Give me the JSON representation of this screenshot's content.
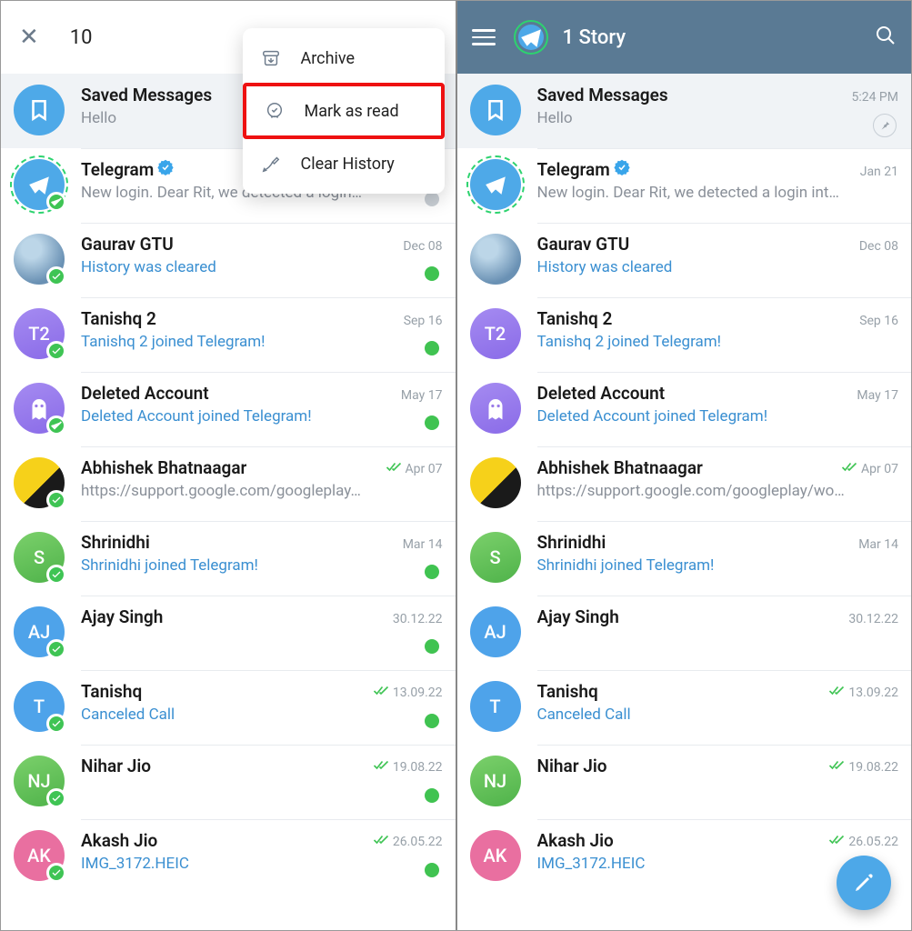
{
  "left": {
    "selected_count": "10",
    "menu": {
      "archive": "Archive",
      "mark_read": "Mark as read",
      "clear_history": "Clear History"
    }
  },
  "right": {
    "title": "1 Story"
  },
  "chats": [
    {
      "name": "Saved Messages",
      "msg": "Hello",
      "date_left": "",
      "date_right": "5:24 PM",
      "link": false,
      "verified": false,
      "read": false
    },
    {
      "name": "Telegram",
      "msg_left": "New login. Dear Rit, we detected a login…",
      "msg_right": "New login. Dear Rit, we detected a login int…",
      "date_left": "",
      "date_right": "Jan 21",
      "link": false,
      "verified": true,
      "read": false
    },
    {
      "name": "Gaurav GTU",
      "msg": "History was cleared",
      "date": "Dec 08",
      "link": true,
      "read": false
    },
    {
      "name": "Tanishq 2",
      "msg": "Tanishq 2 joined Telegram!",
      "date": "Sep 16",
      "link": true,
      "initials": "T2"
    },
    {
      "name": "Deleted Account",
      "msg": "Deleted Account joined Telegram!",
      "date": "May 17",
      "link": true
    },
    {
      "name": "Abhishek Bhatnaagar",
      "msg_left": "https://support.google.com/googleplay…",
      "msg_right": "https://support.google.com/googleplay/wo…",
      "date": "Apr 07",
      "link": false,
      "read": true
    },
    {
      "name": "Shrinidhi",
      "msg": "Shrinidhi joined Telegram!",
      "date": "Mar 14",
      "link": true,
      "initials": "S"
    },
    {
      "name": "Ajay Singh",
      "msg": "",
      "date": "30.12.22",
      "initials": "AJ"
    },
    {
      "name": "Tanishq",
      "msg": "Canceled Call",
      "date": "13.09.22",
      "link": true,
      "initials": "T",
      "read": true
    },
    {
      "name": "Nihar Jio",
      "msg": "",
      "date": "19.08.22",
      "initials": "NJ",
      "read": true
    },
    {
      "name": "Akash Jio",
      "msg": "IMG_3172.HEIC",
      "date": "26.05.22",
      "link": true,
      "initials": "AK",
      "read": true
    }
  ]
}
